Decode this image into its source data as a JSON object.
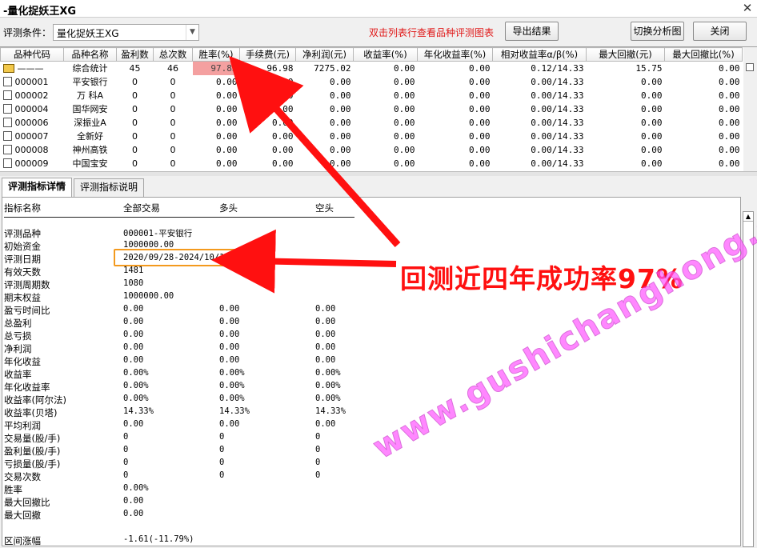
{
  "window": {
    "title": "-量化捉妖王XG"
  },
  "toolbar": {
    "condition_label": "评测条件：",
    "condition_value": "量化捉妖王XG",
    "hint": "双击列表行查看品种评测图表",
    "export_label": "导出结果",
    "switch_label": "切换分析图",
    "close_label": "关闭"
  },
  "grid": {
    "columns": [
      "品种代码",
      "品种名称",
      "盈利数",
      "总次数",
      "胜率(%)",
      "手续费(元)",
      "净利润(元)",
      "收益率(%)",
      "年化收益率(%)",
      "相对收益率α/β(%)",
      "最大回撤(元)",
      "最大回撤比(%)"
    ],
    "rows": [
      {
        "code": "———",
        "name": "综合统计",
        "win": "45",
        "total": "46",
        "rate": "97.83",
        "fee": "96.98",
        "profit": "7275.02",
        "ret": "0.00",
        "annual": "0.00",
        "rel": "0.12/14.33",
        "dd": "15.75",
        "ddr": "0.00"
      },
      {
        "code": "000001",
        "name": "平安银行",
        "win": "0",
        "total": "0",
        "rate": "0.00",
        "fee": "0.00",
        "profit": "0.00",
        "ret": "0.00",
        "annual": "0.00",
        "rel": "0.00/14.33",
        "dd": "0.00",
        "ddr": "0.00"
      },
      {
        "code": "000002",
        "name": "万 科A",
        "win": "0",
        "total": "0",
        "rate": "0.00",
        "fee": "0.00",
        "profit": "0.00",
        "ret": "0.00",
        "annual": "0.00",
        "rel": "0.00/14.33",
        "dd": "0.00",
        "ddr": "0.00"
      },
      {
        "code": "000004",
        "name": "国华网安",
        "win": "0",
        "total": "0",
        "rate": "0.00",
        "fee": "0.00",
        "profit": "0.00",
        "ret": "0.00",
        "annual": "0.00",
        "rel": "0.00/14.33",
        "dd": "0.00",
        "ddr": "0.00"
      },
      {
        "code": "000006",
        "name": "深振业A",
        "win": "0",
        "total": "0",
        "rate": "0.00",
        "fee": "0.00",
        "profit": "0.00",
        "ret": "0.00",
        "annual": "0.00",
        "rel": "0.00/14.33",
        "dd": "0.00",
        "ddr": "0.00"
      },
      {
        "code": "000007",
        "name": "全新好",
        "win": "0",
        "total": "0",
        "rate": "0.00",
        "fee": "0.00",
        "profit": "0.00",
        "ret": "0.00",
        "annual": "0.00",
        "rel": "0.00/14.33",
        "dd": "0.00",
        "ddr": "0.00"
      },
      {
        "code": "000008",
        "name": "神州高铁",
        "win": "0",
        "total": "0",
        "rate": "0.00",
        "fee": "0.00",
        "profit": "0.00",
        "ret": "0.00",
        "annual": "0.00",
        "rel": "0.00/14.33",
        "dd": "0.00",
        "ddr": "0.00"
      },
      {
        "code": "000009",
        "name": "中国宝安",
        "win": "0",
        "total": "0",
        "rate": "0.00",
        "fee": "0.00",
        "profit": "0.00",
        "ret": "0.00",
        "annual": "0.00",
        "rel": "0.00/14.33",
        "dd": "0.00",
        "ddr": "0.00"
      }
    ]
  },
  "tabs": [
    "评测指标详情",
    "评测指标说明"
  ],
  "detail": {
    "headers": [
      "指标名称",
      "全部交易",
      "多头",
      "空头"
    ],
    "rows": [
      {
        "name": "评测品种",
        "all": "000001-平安银行",
        "long": "",
        "short": ""
      },
      {
        "name": "初始资金",
        "all": "1000000.00",
        "long": "",
        "short": ""
      },
      {
        "name": "评测日期",
        "all": "2020/09/28-2024/10/18",
        "long": "",
        "short": ""
      },
      {
        "name": "有效天数",
        "all": "1481",
        "long": "",
        "short": ""
      },
      {
        "name": "评测周期数",
        "all": "1080",
        "long": "",
        "short": ""
      },
      {
        "name": "期末权益",
        "all": "1000000.00",
        "long": "",
        "short": ""
      },
      {
        "name": "盈亏时间比",
        "all": "0.00",
        "long": "0.00",
        "short": "0.00"
      },
      {
        "name": "总盈利",
        "all": "0.00",
        "long": "0.00",
        "short": "0.00"
      },
      {
        "name": "总亏损",
        "all": "0.00",
        "long": "0.00",
        "short": "0.00"
      },
      {
        "name": "净利润",
        "all": "0.00",
        "long": "0.00",
        "short": "0.00"
      },
      {
        "name": "年化收益",
        "all": "0.00",
        "long": "0.00",
        "short": "0.00"
      },
      {
        "name": "收益率",
        "all": "0.00%",
        "long": "0.00%",
        "short": "0.00%"
      },
      {
        "name": "年化收益率",
        "all": "0.00%",
        "long": "0.00%",
        "short": "0.00%"
      },
      {
        "name": "收益率(阿尔法)",
        "all": "0.00%",
        "long": "0.00%",
        "short": "0.00%"
      },
      {
        "name": "收益率(贝塔)",
        "all": "14.33%",
        "long": "14.33%",
        "short": "14.33%"
      },
      {
        "name": "平均利润",
        "all": "0.00",
        "long": "0.00",
        "short": "0.00"
      },
      {
        "name": "交易量(股/手)",
        "all": "0",
        "long": "0",
        "short": "0"
      },
      {
        "name": "盈利量(股/手)",
        "all": "0",
        "long": "0",
        "short": "0"
      },
      {
        "name": "亏损量(股/手)",
        "all": "0",
        "long": "0",
        "short": "0"
      },
      {
        "name": "交易次数",
        "all": "0",
        "long": "0",
        "short": "0"
      },
      {
        "name": "胜率",
        "all": "0.00%",
        "long": "",
        "short": ""
      },
      {
        "name": "最大回撤比",
        "all": "0.00",
        "long": "",
        "short": ""
      },
      {
        "name": "最大回撤",
        "all": "0.00",
        "long": "",
        "short": ""
      },
      {
        "name": "",
        "all": "",
        "long": "",
        "short": ""
      },
      {
        "name": "区间涨幅",
        "all": "-1.61(-11.79%)",
        "long": "",
        "short": ""
      }
    ]
  },
  "annotation": {
    "text": "回测近四年成功率97%",
    "color": "#ff1010",
    "box_color": "#f39a1e"
  },
  "watermark": {
    "text": "www.gushichanghong.com",
    "color": "#ff55ff"
  }
}
